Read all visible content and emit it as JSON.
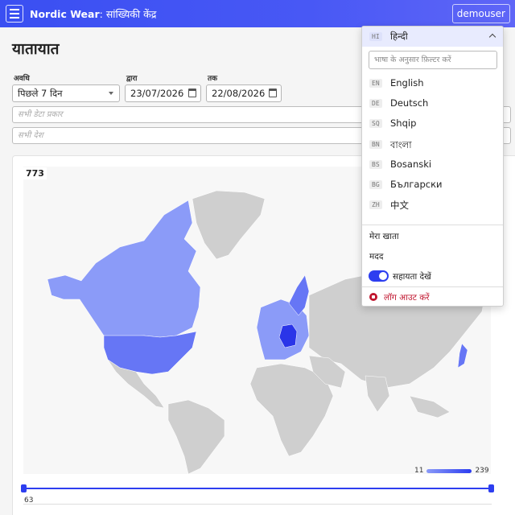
{
  "header": {
    "brand": "Nordic Wear",
    "subtitle": ": सांख्यिकी केंद्र",
    "user": "demouser"
  },
  "page": {
    "title": "यातायात"
  },
  "filters": {
    "period_label": "अवधि",
    "period_value": "पिछले 7 दिन",
    "from_label": "द्वारा",
    "from_value": "23/07/2026",
    "to_label": "तक",
    "to_value": "22/08/2026",
    "data_types_placeholder": "सभी डेटा प्रकार",
    "countries_placeholder": "सभी देश"
  },
  "map": {
    "total": "773",
    "scale_min": "11",
    "scale_max": "239",
    "colors": {
      "base": "#cfcfcf",
      "low": "#8b9bf8",
      "mid": "#6676f5",
      "high": "#2a35e8"
    }
  },
  "timeline": {
    "min_label": "63"
  },
  "language_menu": {
    "selected": {
      "code": "HI",
      "name": "हिन्दी"
    },
    "filter_placeholder": "भाषा के अनुसार फ़िल्टर करें",
    "languages": [
      {
        "code": "EN",
        "name": "English"
      },
      {
        "code": "DE",
        "name": "Deutsch"
      },
      {
        "code": "SQ",
        "name": "Shqip"
      },
      {
        "code": "BN",
        "name": "বাংলা"
      },
      {
        "code": "BS",
        "name": "Bosanski"
      },
      {
        "code": "BG",
        "name": "Български"
      },
      {
        "code": "ZH",
        "name": "中文"
      }
    ],
    "account": "मेरा खाता",
    "help": "मदद",
    "view_help": "सहायता देखें",
    "logout": "लॉग आउट करें"
  },
  "colors": {
    "accent": "#2d3ef0",
    "danger": "#c0152e"
  }
}
